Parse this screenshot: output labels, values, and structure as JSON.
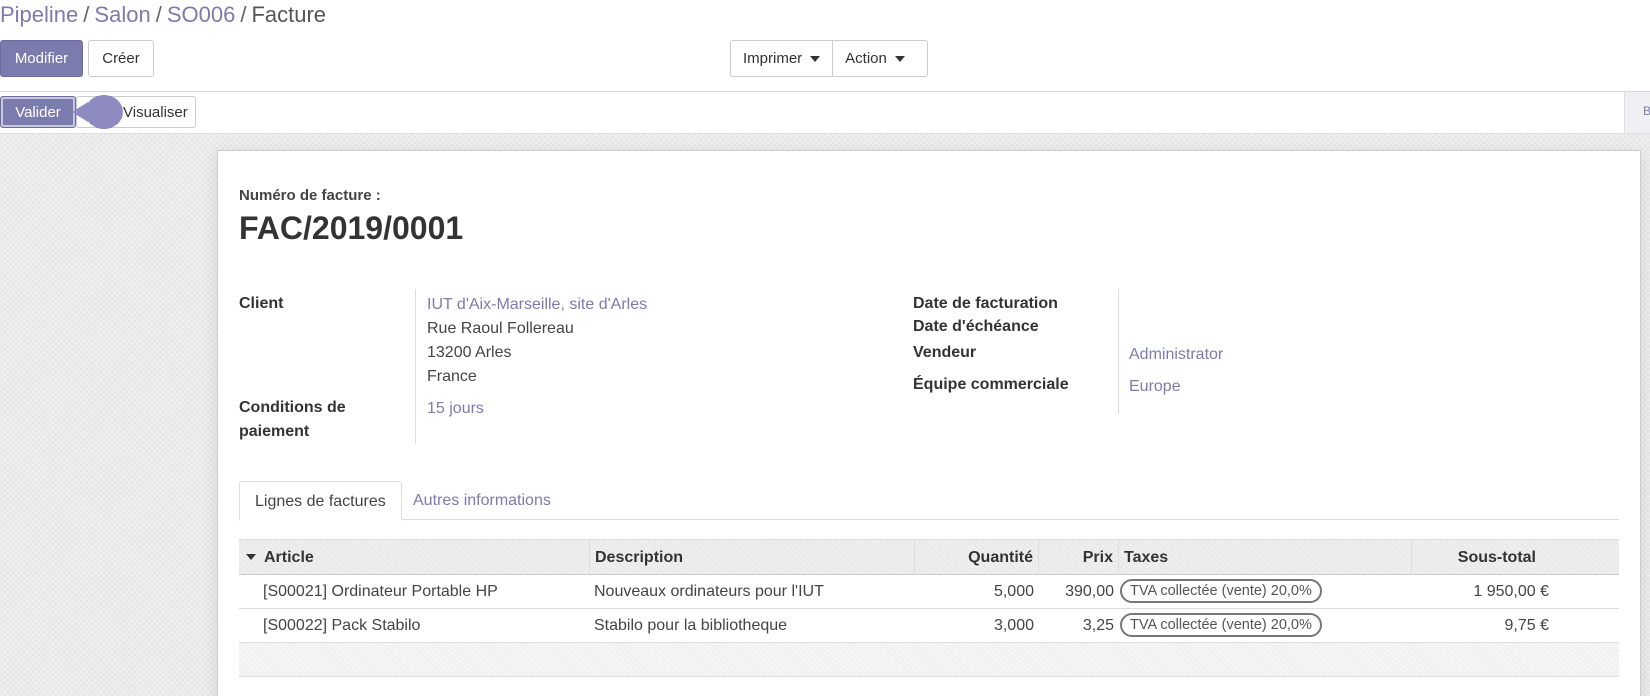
{
  "breadcrumb": {
    "items": [
      "Pipeline",
      "Salon",
      "SO006"
    ],
    "separator": "/",
    "current": "Facture"
  },
  "toolbar": {
    "edit_label": "Modifier",
    "create_label": "Créer",
    "print_label": "Imprimer",
    "action_label": "Action"
  },
  "statusbar": {
    "validate_label": "Valider",
    "preview_label": "Visualiser",
    "right_tab_label": "B"
  },
  "invoice": {
    "number_label": "Numéro de facture :",
    "number": "FAC/2019/0001"
  },
  "fields": {
    "client_label": "Client",
    "client_name": "IUT d'Aix-Marseille, site d'Arles",
    "client_address": [
      "Rue Raoul Follereau",
      "13200 Arles",
      "France"
    ],
    "payment_terms_label_1": "Conditions de",
    "payment_terms_label_2": "paiement",
    "payment_terms_value": "15 jours",
    "invoice_date_label": "Date de facturation",
    "due_date_label": "Date d'échéance",
    "salesperson_label": "Vendeur",
    "salesperson_value": "Administrator",
    "sales_team_label": "Équipe commerciale",
    "sales_team_value": "Europe"
  },
  "tabs": [
    "Lignes de factures",
    "Autres informations"
  ],
  "lines_table": {
    "columns": [
      "Article",
      "Description",
      "Quantité",
      "Prix",
      "Taxes",
      "Sous-total"
    ],
    "rows": [
      {
        "article": "[S00021] Ordinateur Portable HP",
        "description": "Nouveaux ordinateurs pour l'IUT",
        "quantity": "5,000",
        "price": "390,00",
        "taxes": "TVA collectée (vente) 20,0%",
        "subtotal": "1 950,00 €"
      },
      {
        "article": "[S00022] Pack Stabilo",
        "description": "Stabilo pour la bibliotheque",
        "quantity": "3,000",
        "price": "3,25",
        "taxes": "TVA collectée (vente) 20,0%",
        "subtotal": "9,75 €"
      }
    ]
  },
  "colors": {
    "accent": "#7c7bad",
    "tip_bubble": "#8d8bc0"
  }
}
